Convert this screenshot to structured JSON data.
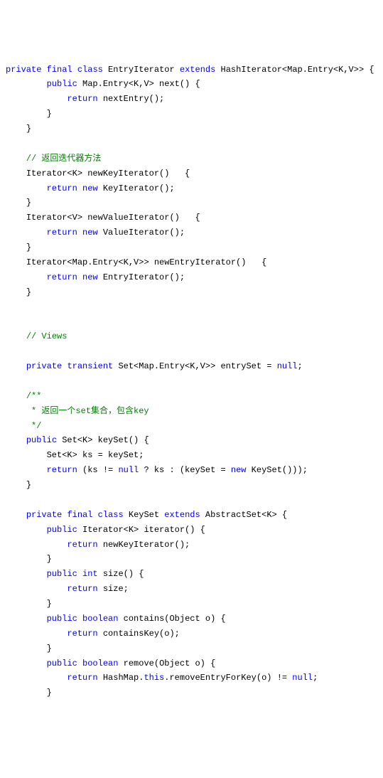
{
  "lines": [
    {
      "indent": 0,
      "tokens": [
        {
          "t": "private",
          "c": "kw"
        },
        {
          "t": " "
        },
        {
          "t": "final",
          "c": "kw"
        },
        {
          "t": " "
        },
        {
          "t": "class",
          "c": "kw"
        },
        {
          "t": " EntryIterator "
        },
        {
          "t": "extends",
          "c": "kw"
        },
        {
          "t": " HashIterator<Map.Entry<K,V>> {"
        }
      ]
    },
    {
      "indent": 2,
      "tokens": [
        {
          "t": "public",
          "c": "kw"
        },
        {
          "t": " Map.Entry<K,V> next() {"
        }
      ]
    },
    {
      "indent": 3,
      "tokens": [
        {
          "t": "return",
          "c": "kw"
        },
        {
          "t": " nextEntry();"
        }
      ]
    },
    {
      "indent": 2,
      "tokens": [
        {
          "t": "}"
        }
      ]
    },
    {
      "indent": 1,
      "tokens": [
        {
          "t": "}"
        }
      ]
    },
    {
      "indent": 0,
      "tokens": [
        {
          "t": ""
        }
      ]
    },
    {
      "indent": 1,
      "tokens": [
        {
          "t": "// 返回迭代器方法",
          "c": "cm"
        }
      ]
    },
    {
      "indent": 1,
      "tokens": [
        {
          "t": "Iterator<K> newKeyIterator()   {"
        }
      ]
    },
    {
      "indent": 2,
      "tokens": [
        {
          "t": "return",
          "c": "kw"
        },
        {
          "t": " "
        },
        {
          "t": "new",
          "c": "kw"
        },
        {
          "t": " KeyIterator();"
        }
      ]
    },
    {
      "indent": 1,
      "tokens": [
        {
          "t": "}"
        }
      ]
    },
    {
      "indent": 1,
      "tokens": [
        {
          "t": "Iterator<V> newValueIterator()   {"
        }
      ]
    },
    {
      "indent": 2,
      "tokens": [
        {
          "t": "return",
          "c": "kw"
        },
        {
          "t": " "
        },
        {
          "t": "new",
          "c": "kw"
        },
        {
          "t": " ValueIterator();"
        }
      ]
    },
    {
      "indent": 1,
      "tokens": [
        {
          "t": "}"
        }
      ]
    },
    {
      "indent": 1,
      "tokens": [
        {
          "t": "Iterator<Map.Entry<K,V>> newEntryIterator()   {"
        }
      ]
    },
    {
      "indent": 2,
      "tokens": [
        {
          "t": "return",
          "c": "kw"
        },
        {
          "t": " "
        },
        {
          "t": "new",
          "c": "kw"
        },
        {
          "t": " EntryIterator();"
        }
      ]
    },
    {
      "indent": 1,
      "tokens": [
        {
          "t": "}"
        }
      ]
    },
    {
      "indent": 0,
      "tokens": [
        {
          "t": ""
        }
      ]
    },
    {
      "indent": 0,
      "tokens": [
        {
          "t": ""
        }
      ]
    },
    {
      "indent": 1,
      "tokens": [
        {
          "t": "// Views",
          "c": "cm"
        }
      ]
    },
    {
      "indent": 0,
      "tokens": [
        {
          "t": ""
        }
      ]
    },
    {
      "indent": 1,
      "tokens": [
        {
          "t": "private",
          "c": "kw"
        },
        {
          "t": " "
        },
        {
          "t": "transient",
          "c": "kw"
        },
        {
          "t": " Set<Map.Entry<K,V>> entrySet = "
        },
        {
          "t": "null",
          "c": "kw"
        },
        {
          "t": ";"
        }
      ]
    },
    {
      "indent": 0,
      "tokens": [
        {
          "t": ""
        }
      ]
    },
    {
      "indent": 1,
      "tokens": [
        {
          "t": "/**",
          "c": "cm"
        }
      ]
    },
    {
      "indent": 1,
      "tokens": [
        {
          "t": " * 返回一个set集合，包含key",
          "c": "cm"
        }
      ]
    },
    {
      "indent": 1,
      "tokens": [
        {
          "t": " */",
          "c": "cm"
        }
      ]
    },
    {
      "indent": 1,
      "tokens": [
        {
          "t": "public",
          "c": "kw"
        },
        {
          "t": " Set<K> keySet() {"
        }
      ]
    },
    {
      "indent": 2,
      "tokens": [
        {
          "t": "Set<K> ks = keySet;"
        }
      ]
    },
    {
      "indent": 2,
      "tokens": [
        {
          "t": "return",
          "c": "kw"
        },
        {
          "t": " (ks != "
        },
        {
          "t": "null",
          "c": "kw"
        },
        {
          "t": " ? ks : (keySet = "
        },
        {
          "t": "new",
          "c": "kw"
        },
        {
          "t": " KeySet()));"
        }
      ]
    },
    {
      "indent": 1,
      "tokens": [
        {
          "t": "}"
        }
      ]
    },
    {
      "indent": 0,
      "tokens": [
        {
          "t": ""
        }
      ]
    },
    {
      "indent": 1,
      "tokens": [
        {
          "t": "private",
          "c": "kw"
        },
        {
          "t": " "
        },
        {
          "t": "final",
          "c": "kw"
        },
        {
          "t": " "
        },
        {
          "t": "class",
          "c": "kw"
        },
        {
          "t": " KeySet "
        },
        {
          "t": "extends",
          "c": "kw"
        },
        {
          "t": " AbstractSet<K> {"
        }
      ]
    },
    {
      "indent": 2,
      "tokens": [
        {
          "t": "public",
          "c": "kw"
        },
        {
          "t": " Iterator<K> iterator() {"
        }
      ]
    },
    {
      "indent": 3,
      "tokens": [
        {
          "t": "return",
          "c": "kw"
        },
        {
          "t": " newKeyIterator();"
        }
      ]
    },
    {
      "indent": 2,
      "tokens": [
        {
          "t": "}"
        }
      ]
    },
    {
      "indent": 2,
      "tokens": [
        {
          "t": "public",
          "c": "kw"
        },
        {
          "t": " "
        },
        {
          "t": "int",
          "c": "kw"
        },
        {
          "t": " size() {"
        }
      ]
    },
    {
      "indent": 3,
      "tokens": [
        {
          "t": "return",
          "c": "kw"
        },
        {
          "t": " size;"
        }
      ]
    },
    {
      "indent": 2,
      "tokens": [
        {
          "t": "}"
        }
      ]
    },
    {
      "indent": 2,
      "tokens": [
        {
          "t": "public",
          "c": "kw"
        },
        {
          "t": " "
        },
        {
          "t": "boolean",
          "c": "kw"
        },
        {
          "t": " contains(Object o) {"
        }
      ]
    },
    {
      "indent": 3,
      "tokens": [
        {
          "t": "return",
          "c": "kw"
        },
        {
          "t": " containsKey(o);"
        }
      ]
    },
    {
      "indent": 2,
      "tokens": [
        {
          "t": "}"
        }
      ]
    },
    {
      "indent": 2,
      "tokens": [
        {
          "t": "public",
          "c": "kw"
        },
        {
          "t": " "
        },
        {
          "t": "boolean",
          "c": "kw"
        },
        {
          "t": " remove(Object o) {"
        }
      ]
    },
    {
      "indent": 3,
      "tokens": [
        {
          "t": "return",
          "c": "kw"
        },
        {
          "t": " HashMap."
        },
        {
          "t": "this",
          "c": "kw"
        },
        {
          "t": ".removeEntryForKey(o) != "
        },
        {
          "t": "null",
          "c": "kw"
        },
        {
          "t": ";"
        }
      ]
    },
    {
      "indent": 2,
      "tokens": [
        {
          "t": "}"
        }
      ]
    }
  ],
  "indentUnit": "    "
}
